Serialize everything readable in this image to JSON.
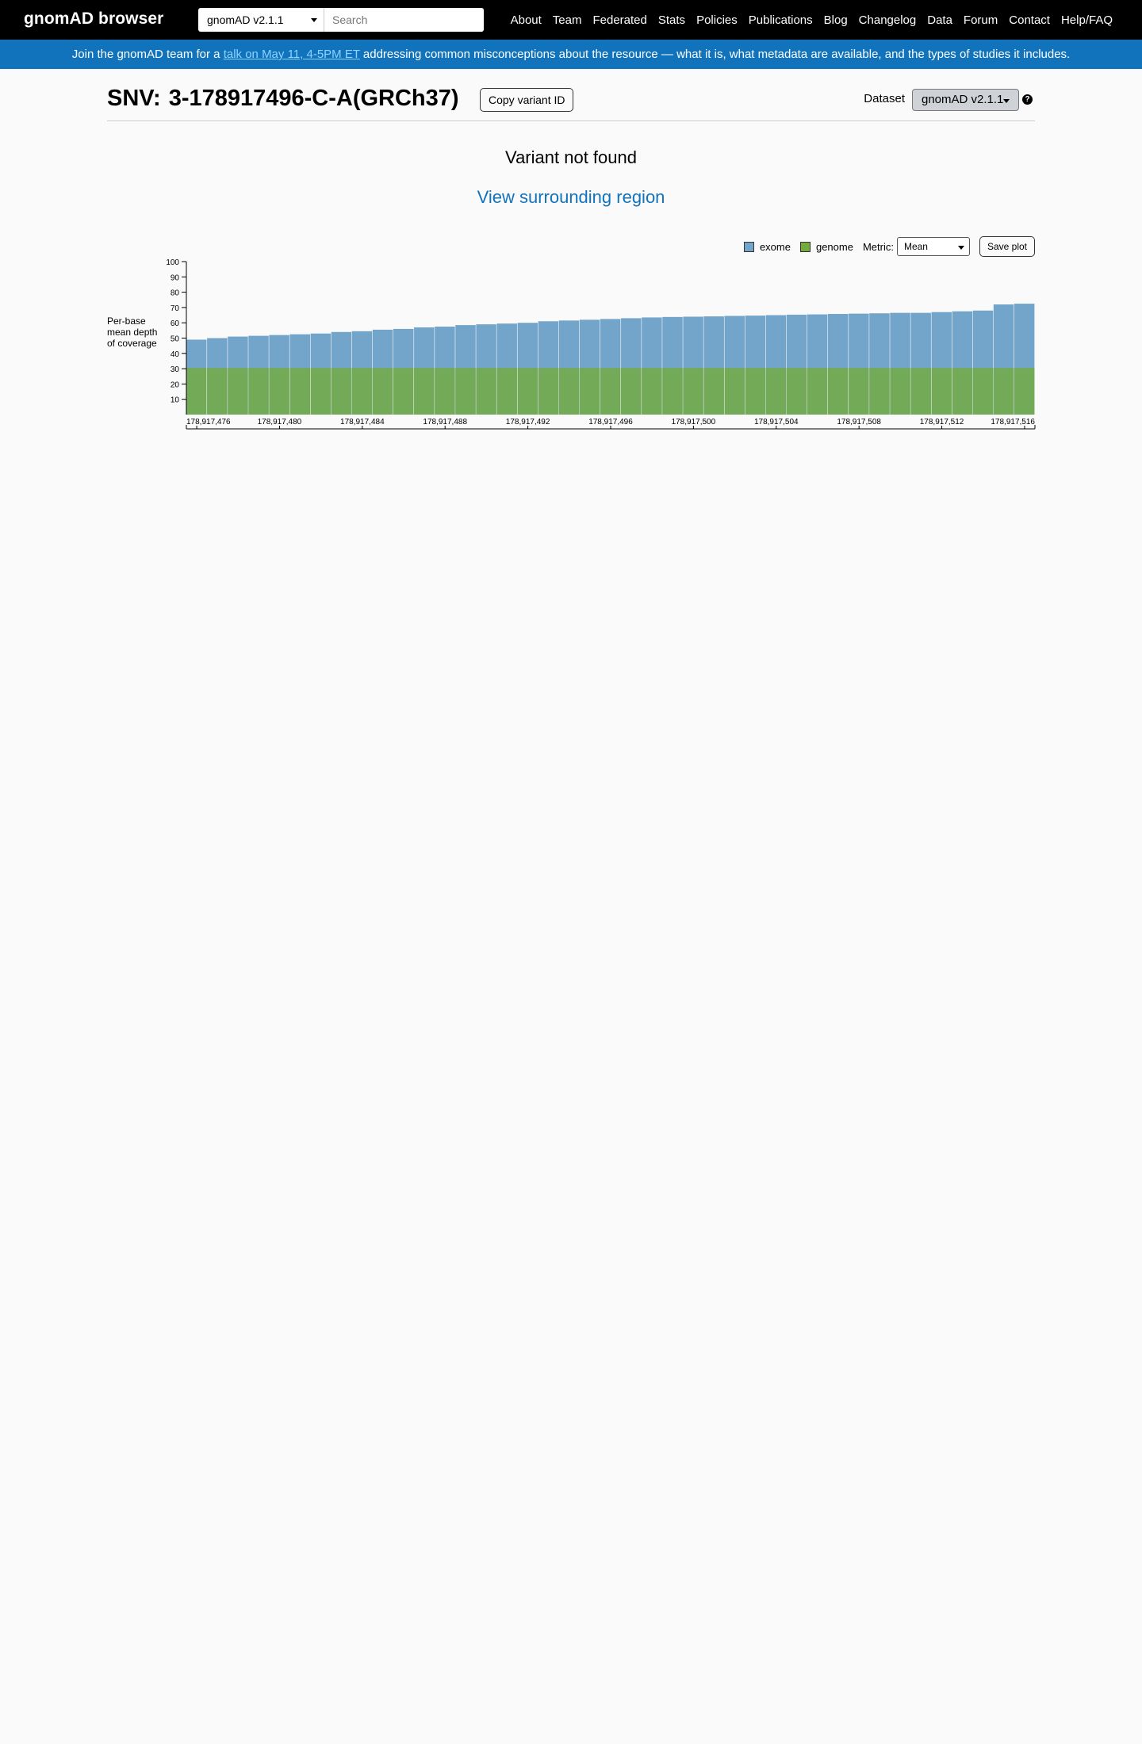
{
  "nav": {
    "brand": "gnomAD browser",
    "dataset_select": "gnomAD v2.1.1",
    "search_placeholder": "Search",
    "links": [
      "About",
      "Team",
      "Federated",
      "Stats",
      "Policies",
      "Publications",
      "Blog",
      "Changelog",
      "Data",
      "Forum",
      "Contact",
      "Help/FAQ"
    ]
  },
  "banner": {
    "prefix": "Join the gnomAD team for a ",
    "link": "talk on May 11, 4-5PM ET",
    "suffix": " addressing common misconceptions about the resource — what it is, what metadata are available, and the types of studies it includes."
  },
  "header": {
    "type_label": "SNV:",
    "variant_id": "3-178917496-C-A(GRCh37)",
    "copy_button": "Copy variant ID",
    "dataset_label": "Dataset",
    "dataset_value": "gnomAD v2.1.1",
    "help_icon": "question-circle-icon"
  },
  "main": {
    "not_found": "Variant not found",
    "view_region": "View surrounding region"
  },
  "controls": {
    "legend": [
      {
        "label": "exome",
        "color": "#73a5ca"
      },
      {
        "label": "genome",
        "color": "#73ab3d"
      }
    ],
    "metric_label": "Metric:",
    "metric_value": "Mean",
    "save_plot": "Save plot"
  },
  "chart_data": {
    "type": "bar",
    "ylabel": "Per-base mean depth of coverage",
    "ylim": [
      0,
      100
    ],
    "yticks": [
      10,
      20,
      30,
      40,
      50,
      60,
      70,
      80,
      90,
      100
    ],
    "xrange": [
      178917476,
      178917517
    ],
    "xticks": [
      178917476,
      178917480,
      178917484,
      178917488,
      178917492,
      178917496,
      178917500,
      178917504,
      178917508,
      178917512,
      178917516
    ],
    "xtick_labels": [
      "178,917,476",
      "178,917,480",
      "178,917,484",
      "178,917,488",
      "178,917,492",
      "178,917,496",
      "178,917,500",
      "178,917,504",
      "178,917,508",
      "178,917,512",
      "178,917,516"
    ],
    "series": [
      {
        "name": "exome",
        "color": "#73a5ca",
        "values": [
          49,
          50,
          51,
          51.5,
          52,
          52.5,
          53,
          54,
          54.5,
          55.5,
          56,
          57,
          57.5,
          58.5,
          59,
          59.5,
          60,
          61,
          61.5,
          62,
          62.5,
          63,
          63.5,
          63.8,
          64,
          64.2,
          64.5,
          64.7,
          65,
          65.3,
          65.5,
          65.8,
          66,
          66.2,
          66.5,
          66.5,
          67,
          67.5,
          68,
          72,
          72.5
        ]
      },
      {
        "name": "genome",
        "color": "#73ab3d",
        "values": [
          30.5,
          30.5,
          30.5,
          30.5,
          30.5,
          30.5,
          30.5,
          30.5,
          30.5,
          30.5,
          30.5,
          30.5,
          30.5,
          30.5,
          30.5,
          30.5,
          30.5,
          30.5,
          30.5,
          30.5,
          30.5,
          30.5,
          30.5,
          30.5,
          30.5,
          30.5,
          30.5,
          30.5,
          30.5,
          30.5,
          30.5,
          30.5,
          30.5,
          30.5,
          30.5,
          30.5,
          30.5,
          30.5,
          30.5,
          30.5,
          30.5
        ]
      }
    ]
  }
}
